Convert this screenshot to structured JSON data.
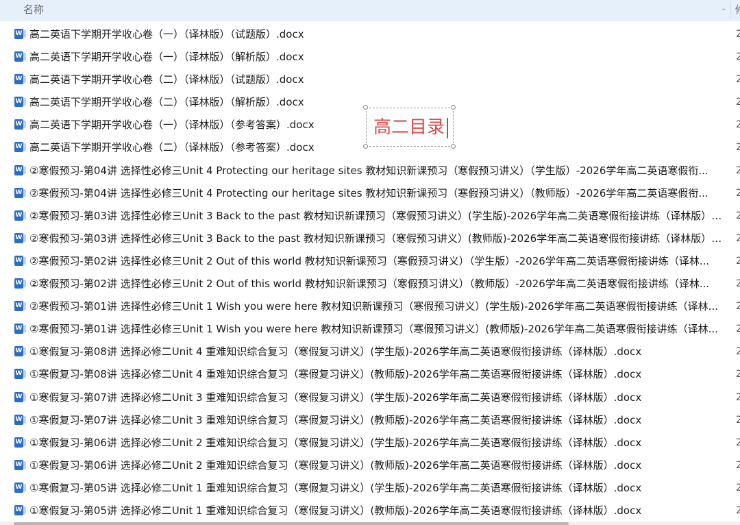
{
  "header": {
    "name_label": "名称",
    "next_column_label": "修",
    "sort_caret": "⌃",
    "chevron": "⌄"
  },
  "file_icon": "word-document-icon",
  "file_icon_glyph": "W",
  "overlay_label": {
    "text": "高二目录",
    "color": "#d94a4a"
  },
  "files": [
    {
      "name": "高二英语下学期开学收心卷（一）（译林版）（试题版）.docx",
      "col2": "2"
    },
    {
      "name": "高二英语下学期开学收心卷（一）（译林版）（解析版）.docx",
      "col2": "2"
    },
    {
      "name": "高二英语下学期开学收心卷（二）（译林版）（试题版）.docx",
      "col2": "2"
    },
    {
      "name": "高二英语下学期开学收心卷（二）（译林版）（解析版）.docx",
      "col2": "2"
    },
    {
      "name": "高二英语下学期开学收心卷（一）（译林版）（参考答案）.docx",
      "col2": "2"
    },
    {
      "name": "高二英语下学期开学收心卷（二）（译林版）（参考答案）.docx",
      "col2": "2"
    },
    {
      "name": "②寒假预习-第04讲 选择性必修三Unit 4 Protecting our heritage sites  教材知识新课预习（寒假预习讲义）（学生版）-2026学年高二英语寒假衔...",
      "col2": "2"
    },
    {
      "name": "②寒假预习-第04讲 选择性必修三Unit 4 Protecting our heritage sites  教材知识新课预习（寒假预习讲义）（教师版）-2026学年高二英语寒假衔...",
      "col2": "2"
    },
    {
      "name": "②寒假预习-第03讲 选择性必修三Unit 3 Back to the past 教材知识新课预习（寒假预习讲义）(学生版)-2026学年高二英语寒假衔接讲练（译林版）....",
      "col2": "2"
    },
    {
      "name": "②寒假预习-第03讲 选择性必修三Unit 3 Back to the past 教材知识新课预习（寒假预习讲义）(教师版)-2026学年高二英语寒假衔接讲练（译林版）....",
      "col2": "2"
    },
    {
      "name": "②寒假预习-第02讲 选择性必修三Unit 2 Out of this world 教材知识新课预习（寒假预习讲义）（学生版）-2026学年高二英语寒假衔接讲练（译林...",
      "col2": "2"
    },
    {
      "name": "②寒假预习-第02讲 选择性必修三Unit 2 Out of this world 教材知识新课预习（寒假预习讲义）（教师版）-2026学年高二英语寒假衔接讲练（译林...",
      "col2": "2"
    },
    {
      "name": "②寒假预习-第01讲 选择性必修三Unit 1 Wish you were here 教材知识新课预习（寒假预习讲义）(学生版)-2026学年高二英语寒假衔接讲练（译林...",
      "col2": "2"
    },
    {
      "name": "②寒假预习-第01讲 选择性必修三Unit 1 Wish you were here 教材知识新课预习（寒假预习讲义）(教师版)-2026学年高二英语寒假衔接讲练（译林...",
      "col2": "2"
    },
    {
      "name": "①寒假复习-第08讲  选择必修二Unit 4  重难知识综合复习（寒假复习讲义）(学生版)-2026学年高二英语寒假衔接讲练（译林版）.docx",
      "col2": "2"
    },
    {
      "name": "①寒假复习-第08讲  选择必修二Unit 4  重难知识综合复习（寒假复习讲义）(教师版)-2026学年高二英语寒假衔接讲练（译林版）.docx",
      "col2": "2"
    },
    {
      "name": "①寒假复习-第07讲  选择必修二Unit 3 重难知识综合复习（寒假复习讲义）(学生版)-2026学年高二英语寒假衔接讲练（译林版）.docx",
      "col2": "2"
    },
    {
      "name": "①寒假复习-第07讲  选择必修二Unit 3 重难知识综合复习（寒假复习讲义）(教师版)-2026学年高二英语寒假衔接讲练（译林版）.docx",
      "col2": "2"
    },
    {
      "name": "①寒假复习-第06讲 选择必修二Unit 2 重难知识综合复习（寒假复习讲义）(学生版)-2026学年高二英语寒假衔接讲练（译林版）.docx",
      "col2": "2"
    },
    {
      "name": "①寒假复习-第06讲 选择必修二Unit 2 重难知识综合复习（寒假复习讲义）(教师版)-2026学年高二英语寒假衔接讲练（译林版）.docx",
      "col2": "2"
    },
    {
      "name": "①寒假复习-第05讲 选择必修二Unit 1 重难知识综合复习（寒假复习讲义）(学生版)-2026学年高二英语寒假衔接讲练（译林版）.docx",
      "col2": "2"
    },
    {
      "name": "①寒假复习-第05讲 选择必修二Unit 1 重难知识综合复习（寒假复习讲义）(教师版)-2026学年高二英语寒假衔接讲练（译林版）.docx",
      "col2": "2"
    }
  ]
}
